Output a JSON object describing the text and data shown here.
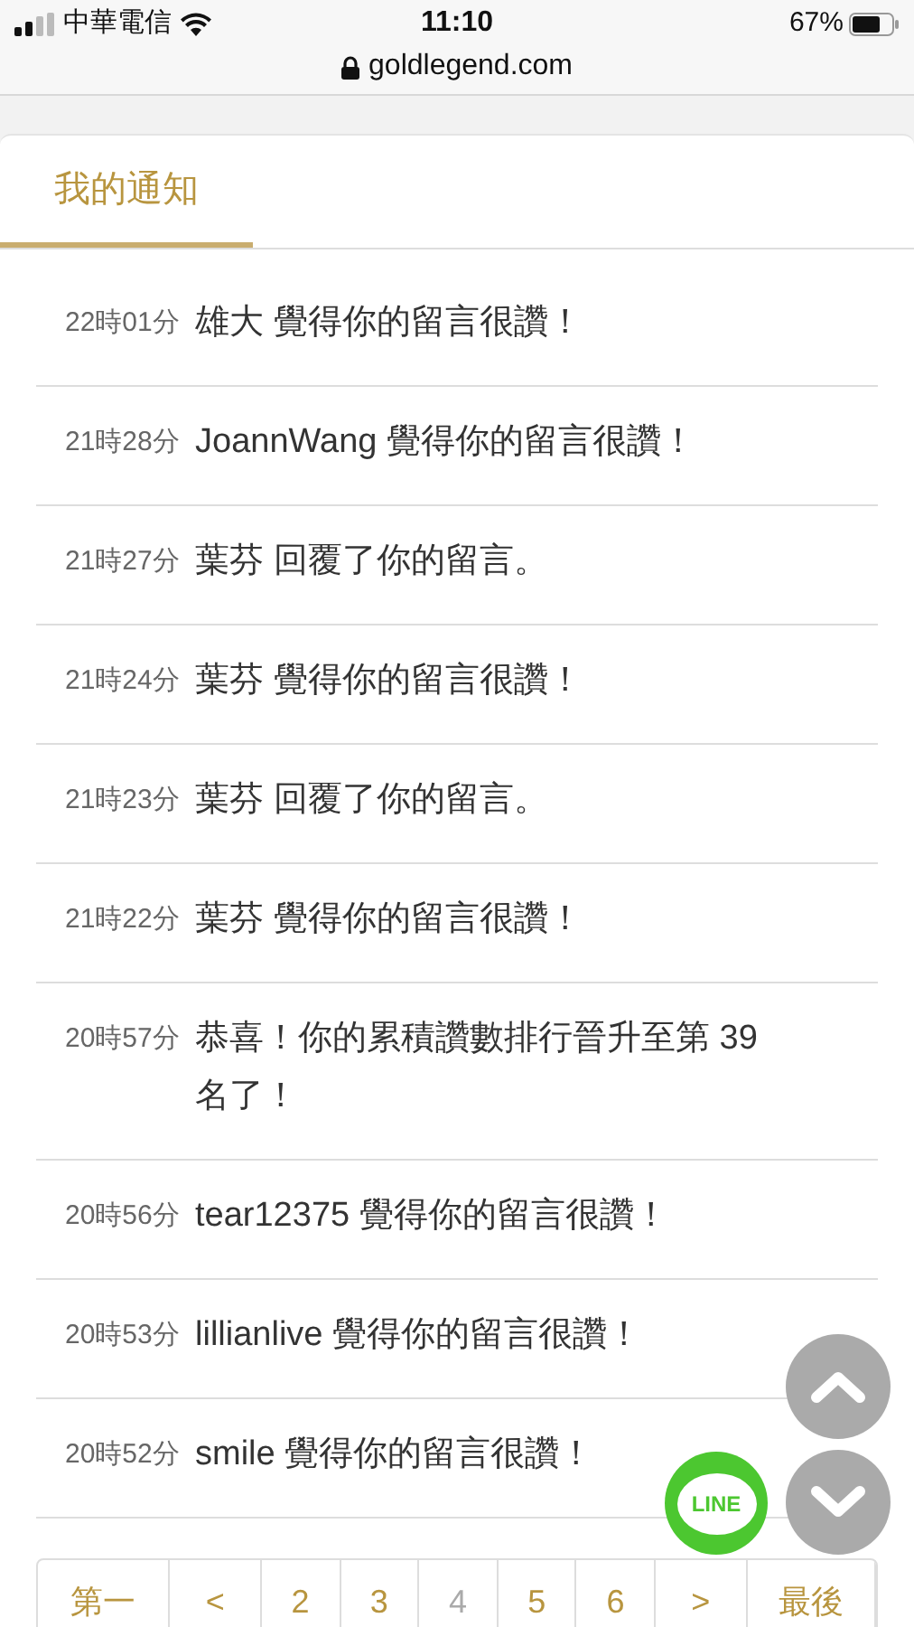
{
  "status_bar": {
    "carrier": "中華電信",
    "time": "11:10",
    "battery": "67%",
    "url": "goldlegend.com"
  },
  "tabs": [
    {
      "label": "我的通知",
      "selected": true
    }
  ],
  "notifications": [
    {
      "time": "22時01分",
      "message": "雄大 覺得你的留言很讚！"
    },
    {
      "time": "21時28分",
      "message": "JoannWang 覺得你的留言很讚！"
    },
    {
      "time": "21時27分",
      "message": "葉芬 回覆了你的留言。"
    },
    {
      "time": "21時24分",
      "message": "葉芬 覺得你的留言很讚！"
    },
    {
      "time": "21時23分",
      "message": "葉芬 回覆了你的留言。"
    },
    {
      "time": "21時22分",
      "message": "葉芬 覺得你的留言很讚！"
    },
    {
      "time": "20時57分",
      "message": "恭喜！你的累積讚數排行晉升至第 39 名了！"
    },
    {
      "time": "20時56分",
      "message": "tear12375 覺得你的留言很讚！"
    },
    {
      "time": "20時53分",
      "message": "lillianlive 覺得你的留言很讚！"
    },
    {
      "time": "20時52分",
      "message": "smile 覺得你的留言很讚！"
    }
  ],
  "pagination": [
    {
      "label": "第一",
      "selected": false
    },
    {
      "label": "<",
      "selected": false
    },
    {
      "label": "2",
      "selected": false
    },
    {
      "label": "3",
      "selected": false
    },
    {
      "label": "4",
      "selected": true
    },
    {
      "label": "5",
      "selected": false
    },
    {
      "label": "6",
      "selected": false
    },
    {
      "label": ">",
      "selected": false
    },
    {
      "label": "最後",
      "selected": false
    }
  ],
  "line_button": {
    "label": "LINE"
  }
}
